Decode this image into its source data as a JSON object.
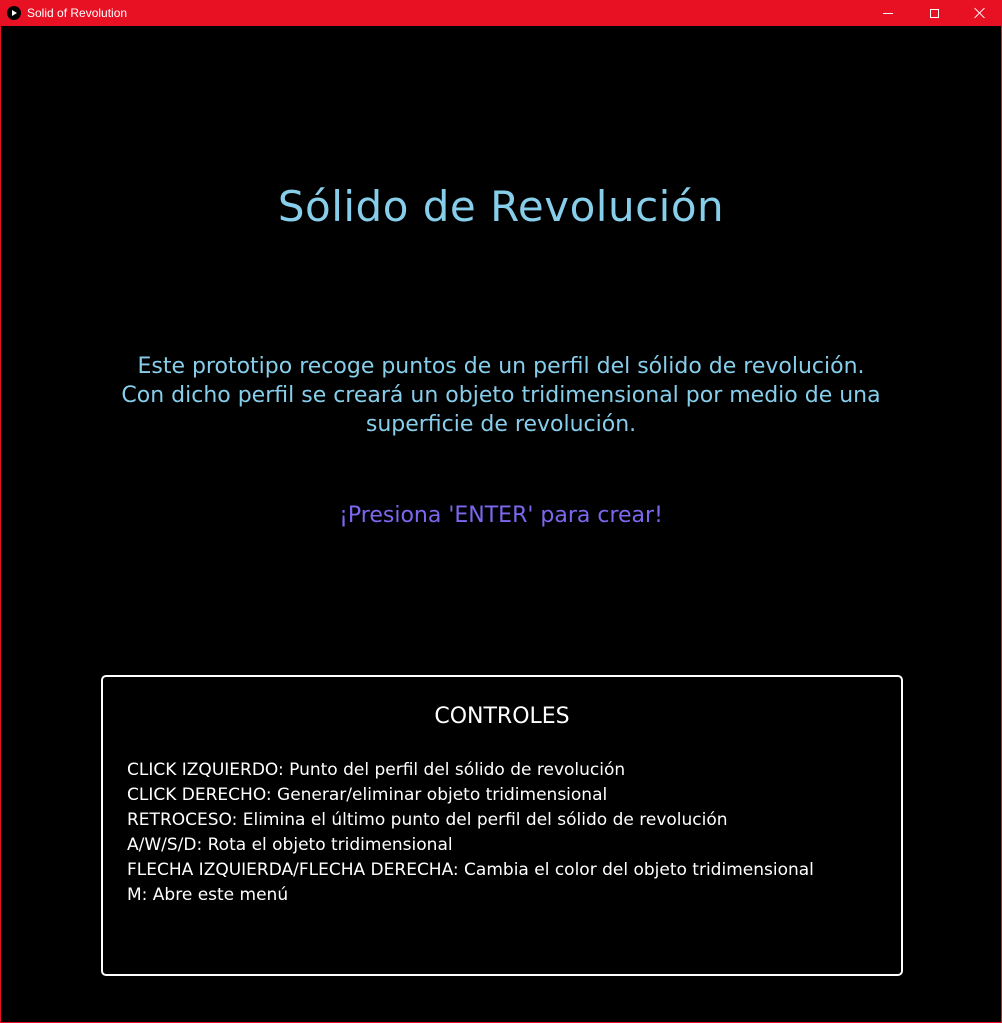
{
  "window": {
    "title": "Solid of Revolution",
    "accent_color": "#e81123",
    "icon": "play-icon"
  },
  "main": {
    "title": "Sólido de Revolución",
    "description": [
      "Este prototipo recoge puntos de un perfil del sólido de revolución.",
      "Con dicho perfil se creará un objeto tridimensional por medio de una",
      "superficie de revolución."
    ],
    "prompt": "¡Presiona 'ENTER' para crear!",
    "title_color": "#87ceeb",
    "prompt_color": "#7b68ee"
  },
  "controls": {
    "title": "CONTROLES",
    "items": [
      "CLICK IZQUIERDO: Punto del perfil del sólido de revolución",
      "CLICK DERECHO: Generar/eliminar objeto tridimensional",
      "RETROCESO: Elimina el último punto del perfil del sólido de revolución",
      "A/W/S/D: Rota el objeto tridimensional",
      "FLECHA IZQUIERDA/FLECHA DERECHA: Cambia el color del objeto tridimensional",
      "M: Abre este menú"
    ]
  }
}
